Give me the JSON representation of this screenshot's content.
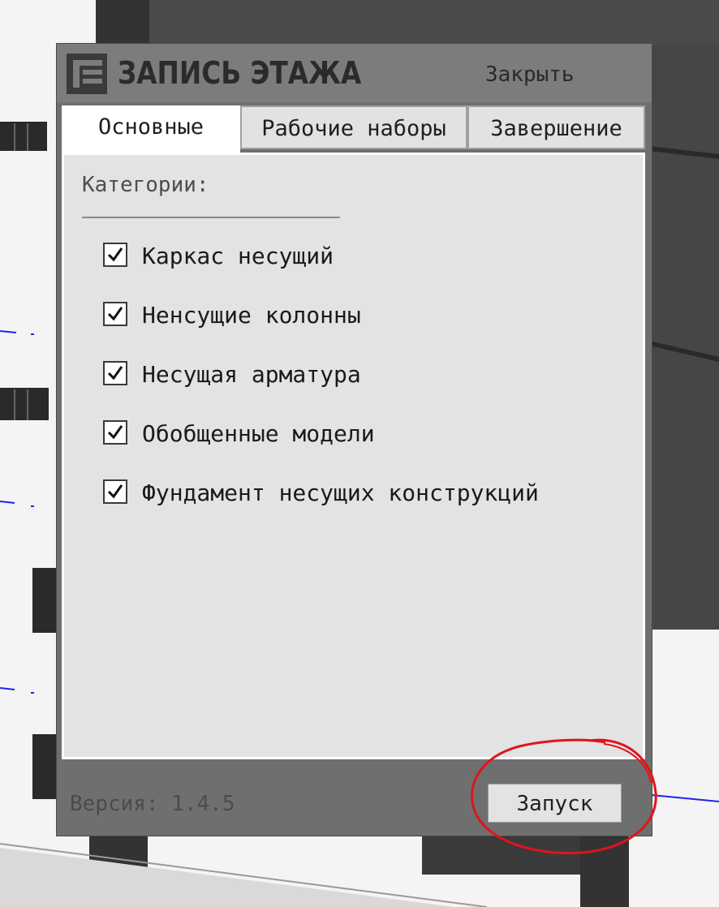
{
  "dialog": {
    "title": "ЗАПИСЬ ЭТАЖА",
    "close_label": "Закрыть",
    "logo_icon": "app-logo-icon"
  },
  "tabs": [
    {
      "label": "Основные",
      "active": true
    },
    {
      "label": "Рабочие наборы",
      "active": false
    },
    {
      "label": "Завершение",
      "active": false
    }
  ],
  "categories": {
    "label": "Категории:",
    "items": [
      {
        "label": "Каркас несущий",
        "checked": true
      },
      {
        "label": "Ненсущие колонны",
        "checked": true
      },
      {
        "label": "Несущая арматура",
        "checked": true
      },
      {
        "label": "Обобщенные модели",
        "checked": true
      },
      {
        "label": "Фундамент несущих конструкций",
        "checked": true
      }
    ]
  },
  "footer": {
    "version": "Версия: 1.4.5",
    "run_label": "Запуск"
  },
  "colors": {
    "annotation": "#e0141a",
    "dialog_frame": "#6f6f6f",
    "title_bar": "#7c7c7c",
    "panel": "#e3e3e3"
  }
}
